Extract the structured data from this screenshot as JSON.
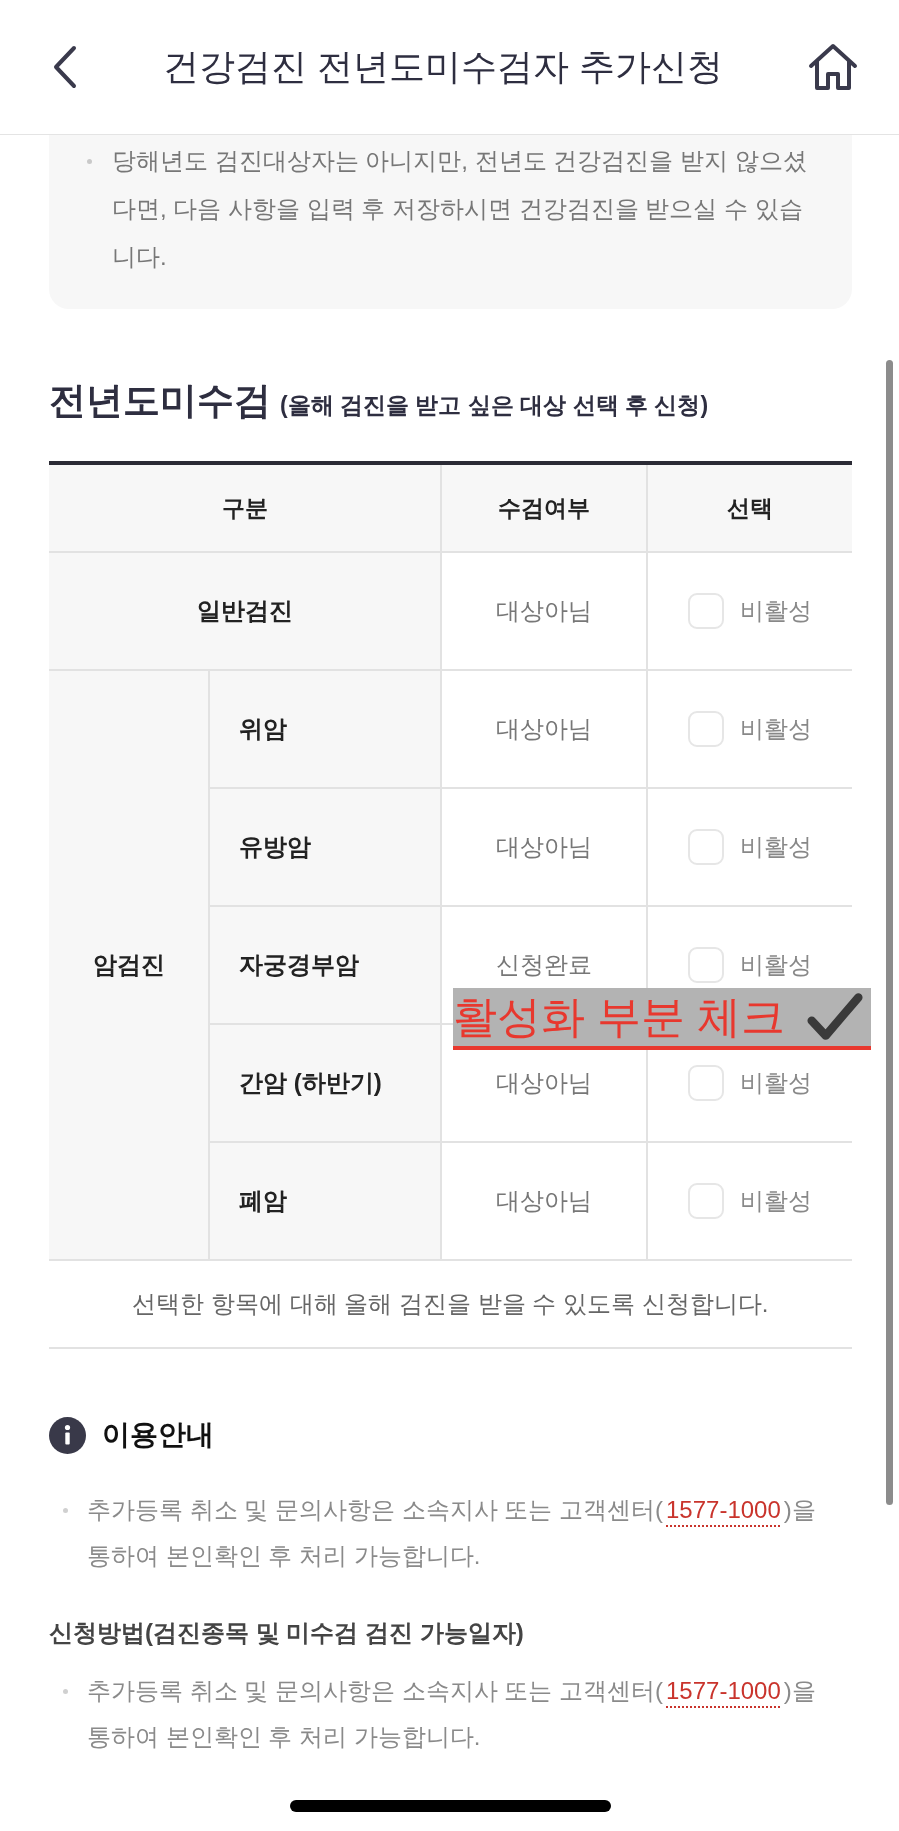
{
  "header": {
    "title": "건강검진 전년도미수검자 추가신청"
  },
  "notice": {
    "items": [
      "당해년도 검진대상자는 아니지만, 전년도 건강검진을 받지 않으셨다면, 다음 사항을 입력 후 저장하시면 건강검진을 받으실 수 있습니다."
    ]
  },
  "section": {
    "title": "전년도미수검",
    "subtitle": "(올해 검진을 받고 싶은 대상 선택 후 신청)"
  },
  "table": {
    "columns": [
      "구분",
      "수검여부",
      "선택"
    ],
    "groups": [
      {
        "label": "일반검진",
        "status": "대상아님",
        "option": {
          "label": "비활성",
          "checked": false,
          "disabled": true
        }
      },
      {
        "label": "암검진",
        "children": [
          {
            "label": "위암",
            "status": "대상아님",
            "option": {
              "label": "비활성",
              "checked": false,
              "disabled": true
            }
          },
          {
            "label": "유방암",
            "status": "대상아님",
            "option": {
              "label": "비활성",
              "checked": false,
              "disabled": true
            }
          },
          {
            "label": "자궁경부암",
            "status": "신청완료",
            "option": {
              "label": "비활성",
              "checked": false,
              "disabled": true
            }
          },
          {
            "label": "간암 (하반기)",
            "status": "대상아님",
            "option": {
              "label": "비활성",
              "checked": false,
              "disabled": true
            }
          },
          {
            "label": "폐암",
            "status": "대상아님",
            "option": {
              "label": "비활성",
              "checked": false,
              "disabled": true
            }
          }
        ]
      }
    ],
    "note": "선택한 항목에 대해 올해 검진을 받을 수 있도록 신청합니다."
  },
  "info": {
    "title": "이용안내",
    "items": [
      {
        "before": "추가등록 취소 및 문의사항은 소속지사 또는 고객센터(",
        "link": "1577-1000",
        "after": ")을 통하여 본인확인 후 처리 가능합니다."
      }
    ]
  },
  "method": {
    "title": "신청방법(검진종목 및 미수검 검진 가능일자)",
    "items": [
      {
        "before": "추가등록 취소 및 문의사항은 소속지사 또는 고객센터(",
        "link": "1577-1000",
        "after": ")을 통하여 본인확인 후 처리 가능합니다."
      }
    ]
  },
  "annotation": {
    "text": "활성화 부분 체크"
  }
}
